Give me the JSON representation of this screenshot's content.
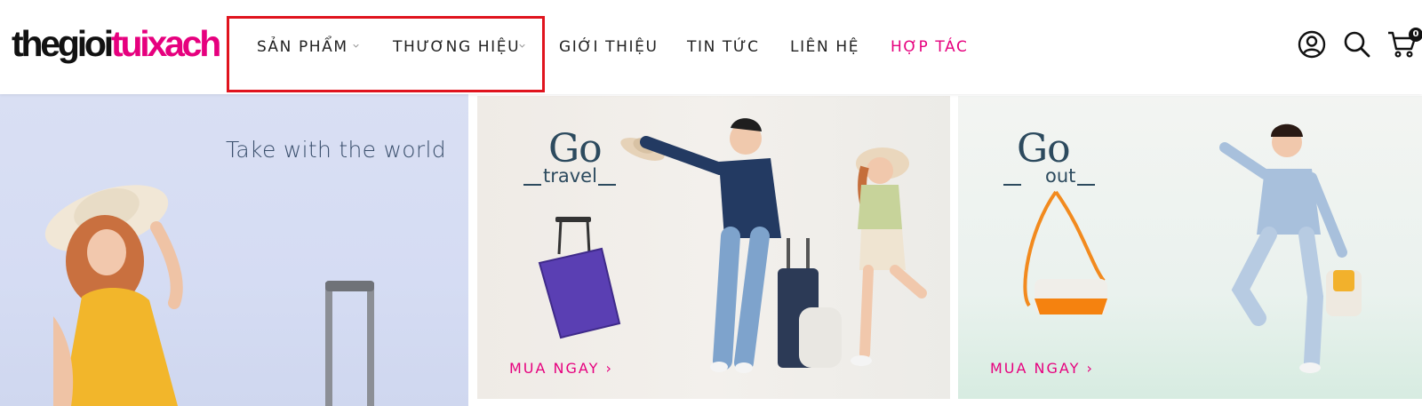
{
  "brand": {
    "logo_part1": "thegioi",
    "logo_part2": "tuixach"
  },
  "nav": {
    "items": [
      {
        "label": "SẢN PHẨM",
        "has_dropdown": true
      },
      {
        "label": "THƯƠNG HIỆU",
        "has_dropdown": true
      },
      {
        "label": "GIỚI THIỆU",
        "has_dropdown": false
      },
      {
        "label": "TIN TỨC",
        "has_dropdown": false
      },
      {
        "label": "LIÊN HỆ",
        "has_dropdown": false
      },
      {
        "label": "HỢP TÁC",
        "has_dropdown": false,
        "accent": true
      }
    ]
  },
  "header_icons": {
    "account": "user-circle-icon",
    "search": "search-icon",
    "cart": "cart-icon",
    "cart_count": "0"
  },
  "banners": [
    {
      "tagline": "Take with the world"
    },
    {
      "headline": "Go",
      "subline": "travel",
      "cta": "MUA NGAY ›"
    },
    {
      "headline": "Go",
      "subline": "out",
      "cta": "MUA NGAY ›"
    }
  ],
  "colors": {
    "brand_pink": "#e6007e",
    "highlight_red": "#e0141e",
    "text_dark": "#222222",
    "heading_blue": "#2c4a5e"
  }
}
